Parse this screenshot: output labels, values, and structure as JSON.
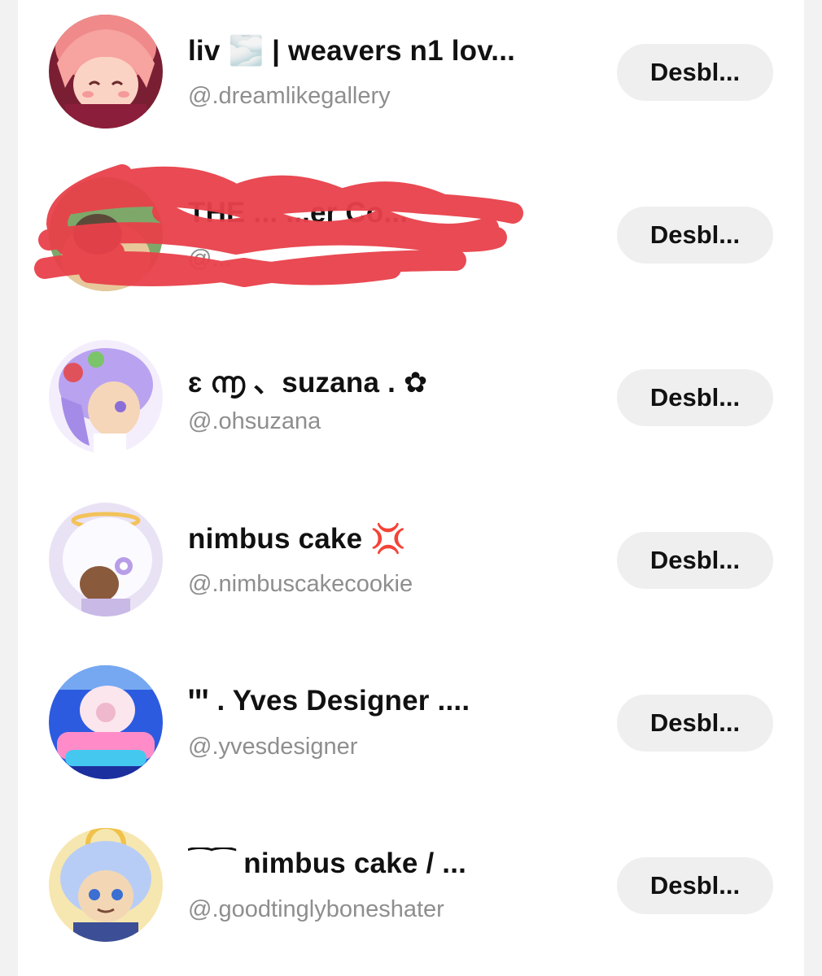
{
  "accent_scribble_color": "#e8414a",
  "blocked_list": [
    {
      "display_name": "liv 🌫️  |  weavers n1 lov...",
      "handle": "@.dreamlikegallery",
      "button_label": "Desbl...",
      "avatar_icon": "pink-haired-character-avatar"
    },
    {
      "display_name": "THE ... ...er Co...",
      "handle": "@...",
      "button_label": "Desbl...",
      "avatar_icon": "redacted-avatar"
    },
    {
      "display_name": "ɛ  ൬  、suzana . ✿",
      "handle": "@.ohsuzana",
      "button_label": "Desbl...",
      "avatar_icon": "lavender-haired-character-avatar"
    },
    {
      "display_name": "nimbus cake 💢",
      "handle": "@.nimbuscakecookie",
      "button_label": "Desbl...",
      "avatar_icon": "white-haired-character-avatar"
    },
    {
      "display_name": "ꞌꞌꞌ  .   Yves Designer   ....",
      "handle": "@.yvesdesigner",
      "button_label": "Desbl...",
      "avatar_icon": "yves-designer-logo-avatar"
    },
    {
      "display_name": "⁀⁀    nimbus cake  /  ...",
      "handle": "@.goodtinglyboneshater",
      "button_label": "Desbl...",
      "avatar_icon": "blue-haired-character-avatar"
    }
  ]
}
